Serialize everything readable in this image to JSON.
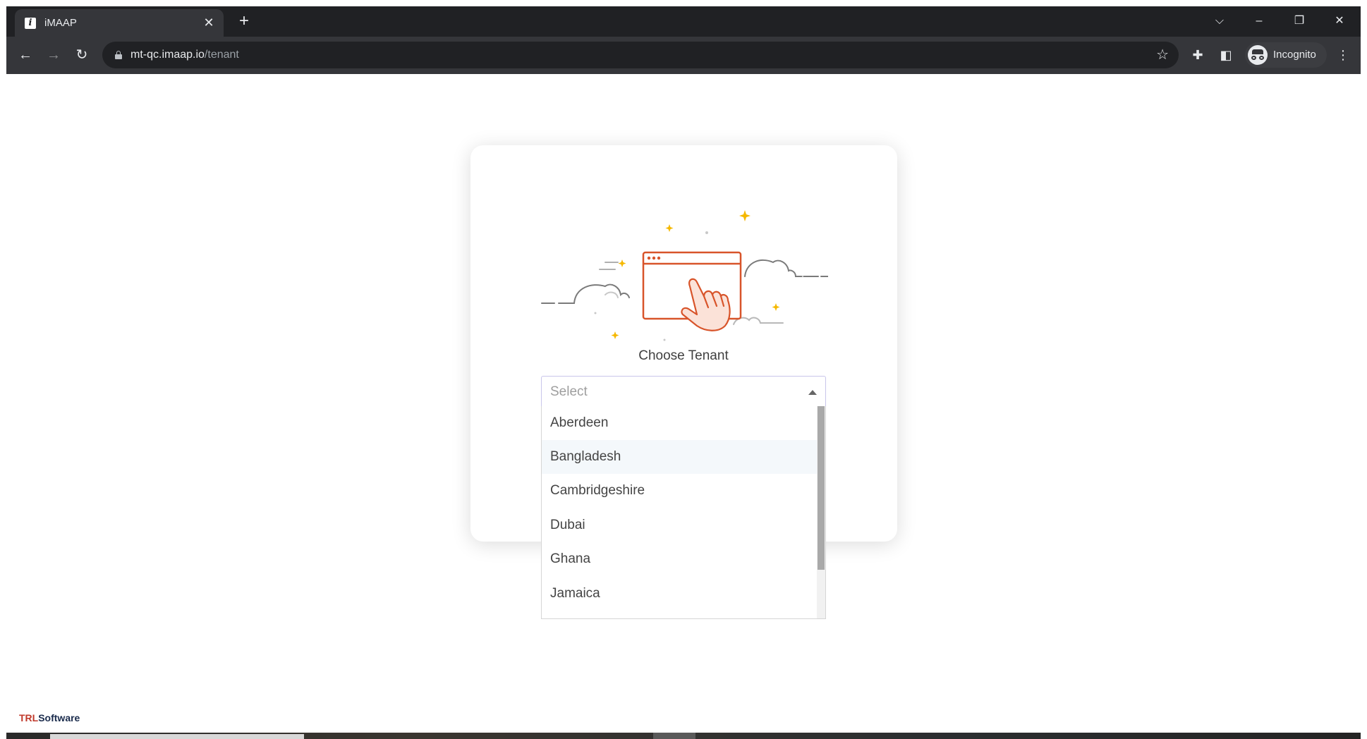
{
  "browser": {
    "tab_title": "iMAAP",
    "favicon_letter": "i",
    "url_host": "mt-qc.imaap.io",
    "url_path": "/tenant",
    "profile_label": "Incognito"
  },
  "page": {
    "heading": "Choose Tenant",
    "select_placeholder": "Select",
    "options": [
      "Aberdeen",
      "Bangladesh",
      "Cambridgeshire",
      "Dubai",
      "Ghana",
      "Jamaica"
    ],
    "highlighted_option": "Bangladesh",
    "footer_logo_accent": "TRL",
    "footer_logo_rest": "Software"
  },
  "colors": {
    "illustration_orange": "#d8542a",
    "sparkle_yellow": "#f5b800",
    "cloud_gray": "#7a7a7a"
  }
}
